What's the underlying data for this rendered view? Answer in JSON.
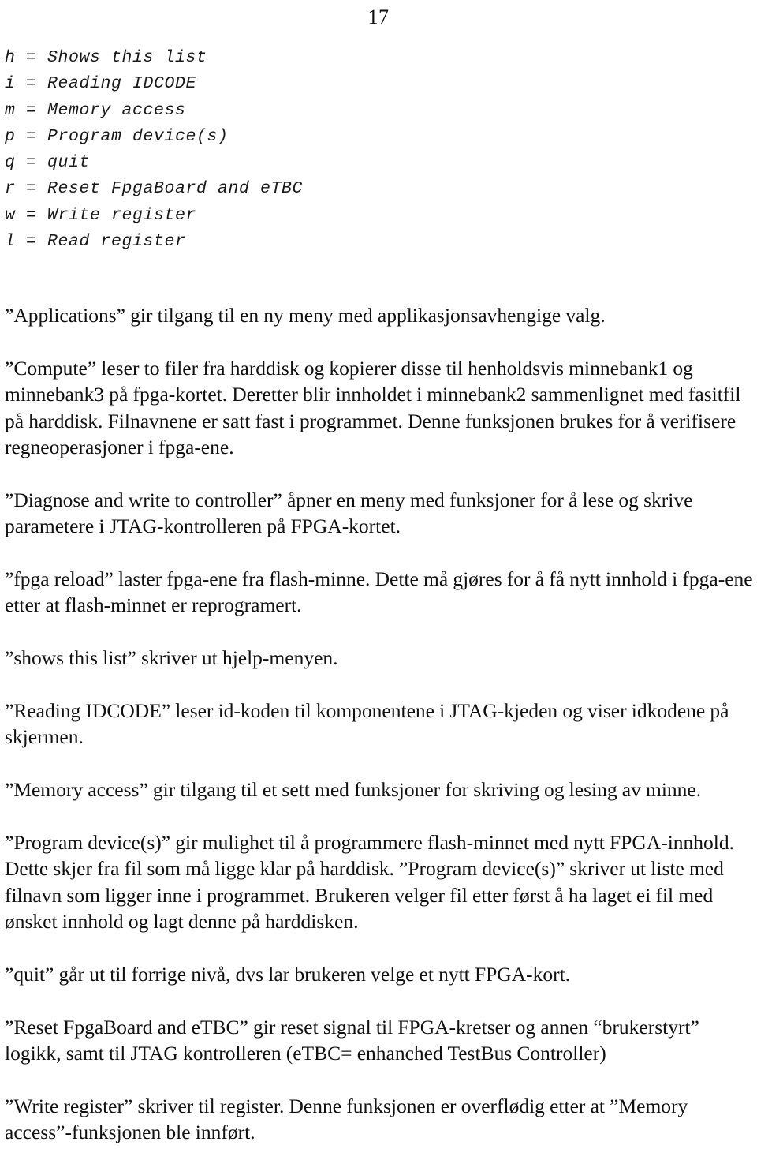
{
  "page": {
    "number": "17"
  },
  "command_list": {
    "lines": [
      "h = Shows this list",
      "i = Reading IDCODE",
      "m = Memory access",
      "p = Program device(s)",
      "q = quit",
      "r = Reset FpgaBoard and eTBC",
      "w = Write register",
      "l = Read register"
    ]
  },
  "body": {
    "paragraphs": [
      "”Applications” gir tilgang til en ny meny med applikasjonsavhengige valg.",
      "”Compute” leser to filer fra harddisk og kopierer disse til henholdsvis minnebank1 og minnebank3 på fpga-kortet. Deretter blir innholdet i minnebank2 sammenlignet med fasitfil på harddisk. Filnavnene er satt fast i programmet. Denne funksjonen brukes for å verifisere regneoperasjoner i fpga-ene.",
      "”Diagnose and write to controller” åpner en meny med funksjoner for å lese og skrive parametere i JTAG-kontrolleren på FPGA-kortet.",
      "”fpga reload” laster fpga-ene fra flash-minne. Dette må gjøres for å få nytt innhold i fpga-ene etter at flash-minnet er reprogramert.",
      "”shows this list” skriver ut hjelp-menyen.",
      "”Reading IDCODE” leser id-koden til komponentene i JTAG-kjeden og viser idkodene på skjermen.",
      "”Memory access” gir tilgang til et sett med funksjoner for skriving og lesing av minne.",
      "”Program device(s)” gir mulighet til å programmere flash-minnet med nytt FPGA-innhold. Dette skjer fra fil som må ligge klar på harddisk. ”Program device(s)” skriver ut liste med filnavn som ligger inne i programmet. Brukeren velger fil etter først å ha laget ei fil med ønsket innhold og lagt denne på harddisken.",
      "”quit” går ut til forrige nivå, dvs lar brukeren velge et nytt FPGA-kort.",
      "”Reset FpgaBoard and eTBC” gir reset signal til FPGA-kretser og annen “brukerstyrt” logikk, samt til JTAG kontrolleren (eTBC= enhanched TestBus Controller)",
      "”Write register” skriver til register. Denne funksjonen er overflødig etter at ”Memory access”-funksjonen ble innført."
    ]
  }
}
